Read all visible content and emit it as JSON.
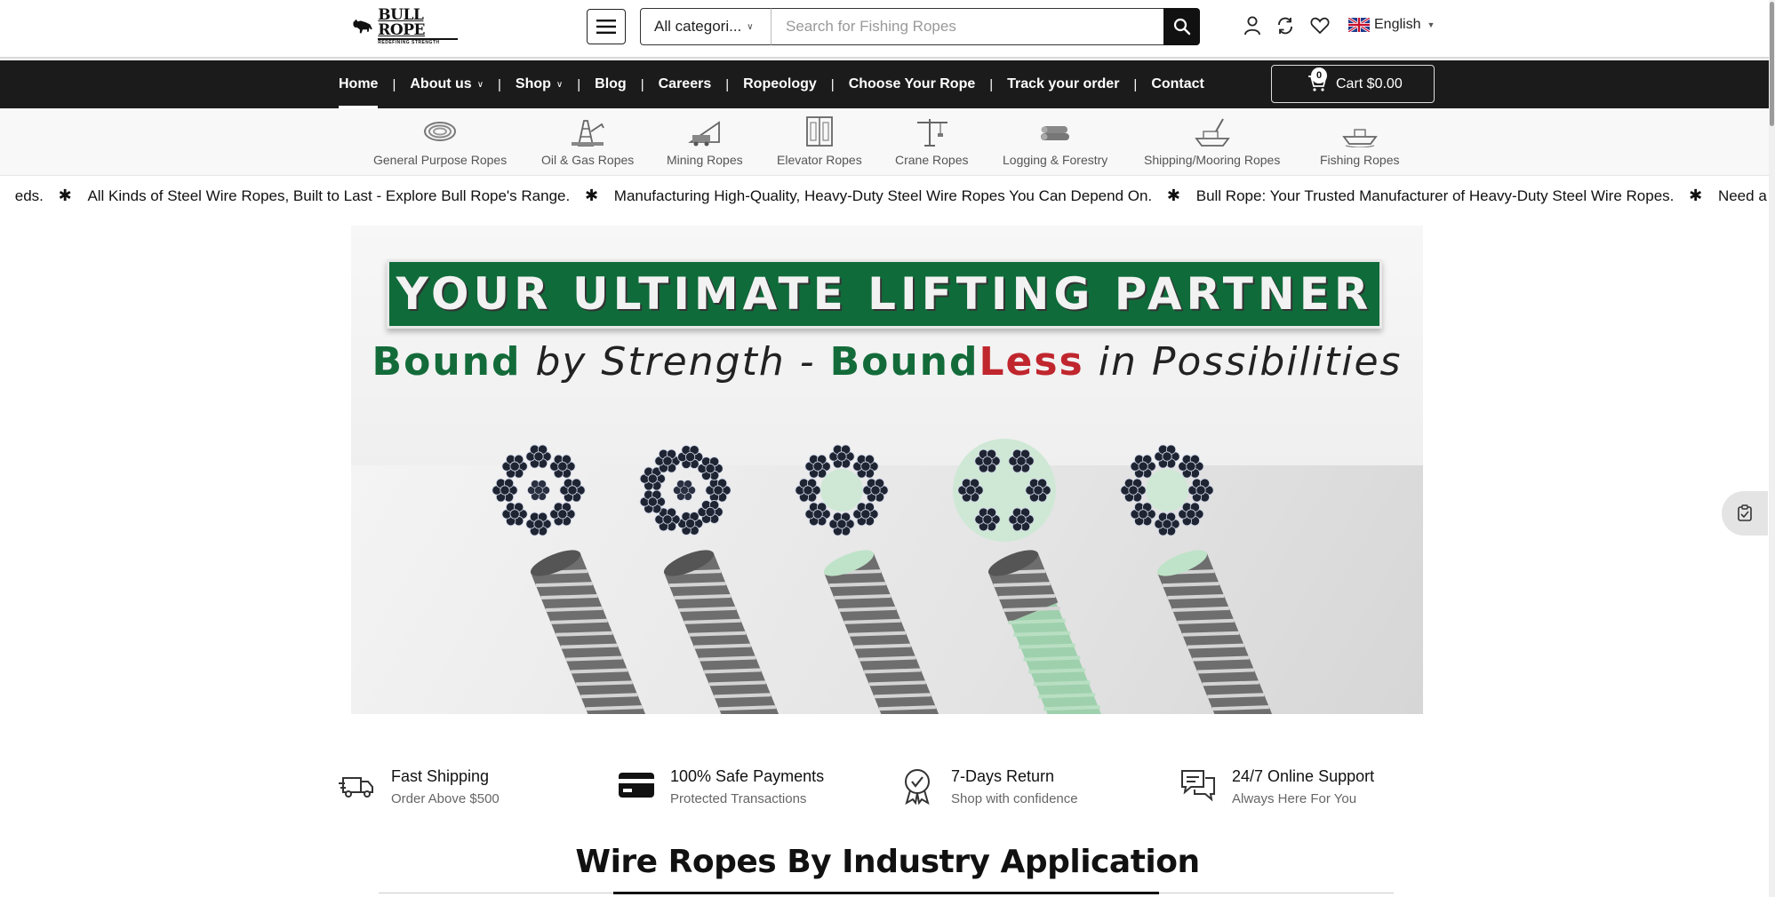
{
  "header": {
    "logo_text": "BULL ROPE",
    "logo_tagline": "REDEFINING STRENGTH",
    "category_select": "All categori...",
    "search_placeholder": "Search for Fishing Ropes",
    "language": "English"
  },
  "nav": {
    "items": [
      {
        "label": "Home",
        "active": true,
        "dropdown": false
      },
      {
        "label": "About us",
        "dropdown": true
      },
      {
        "label": "Shop",
        "dropdown": true
      },
      {
        "label": "Blog",
        "dropdown": false
      },
      {
        "label": "Careers",
        "dropdown": false
      },
      {
        "label": "Ropeology",
        "dropdown": false
      },
      {
        "label": "Choose Your Rope",
        "dropdown": false
      },
      {
        "label": "Track your order",
        "dropdown": false
      },
      {
        "label": "Contact",
        "dropdown": false
      }
    ],
    "cart_count": "0",
    "cart_label": "Cart $0.00"
  },
  "categories": [
    {
      "label": "General Purpose Ropes",
      "icon": "rope-coil-icon"
    },
    {
      "label": "Oil & Gas Ropes",
      "icon": "oil-rig-icon"
    },
    {
      "label": "Mining Ropes",
      "icon": "mining-icon"
    },
    {
      "label": "Elevator Ropes",
      "icon": "elevator-icon"
    },
    {
      "label": "Crane Ropes",
      "icon": "crane-icon"
    },
    {
      "label": "Logging & Forestry",
      "icon": "logs-icon"
    },
    {
      "label": "Shipping/Mooring Ropes",
      "icon": "ship-icon"
    },
    {
      "label": "Fishing Ropes",
      "icon": "fishing-boat-icon"
    }
  ],
  "ticker": [
    "eds.",
    "All Kinds of Steel Wire Ropes, Built to Last - Explore Bull Rope's Range.",
    "Manufacturing High-Quality, Heavy-Duty Steel Wire Ropes You Can Depend On.",
    "Bull Rope: Your Trusted Manufacturer of Heavy-Duty Steel Wire Ropes.",
    "Need a Specific Steel W"
  ],
  "hero": {
    "title": "YOUR ULTIMATE LIFTING PARTNER",
    "sub_bound": "Bound",
    "sub_by_strength": " by Strength - ",
    "sub_bound2": "Bound",
    "sub_less": "Less",
    "sub_in_possibilities": " in Possibilities"
  },
  "features": [
    {
      "title": "Fast Shipping",
      "sub": "Order Above $500",
      "icon": "delivery-truck-icon"
    },
    {
      "title": "100% Safe Payments",
      "sub": "Protected Transactions",
      "icon": "credit-card-icon"
    },
    {
      "title": "7-Days Return",
      "sub": "Shop with confidence",
      "icon": "award-badge-icon"
    },
    {
      "title": "24/7 Online Support",
      "sub": "Always Here For You",
      "icon": "chat-support-icon"
    }
  ],
  "section_title": "Wire Ropes By Industry Application",
  "colors": {
    "nav_bg": "#1b1b1b",
    "hero_green": "#0f6b3a",
    "hero_red": "#c0262d"
  }
}
